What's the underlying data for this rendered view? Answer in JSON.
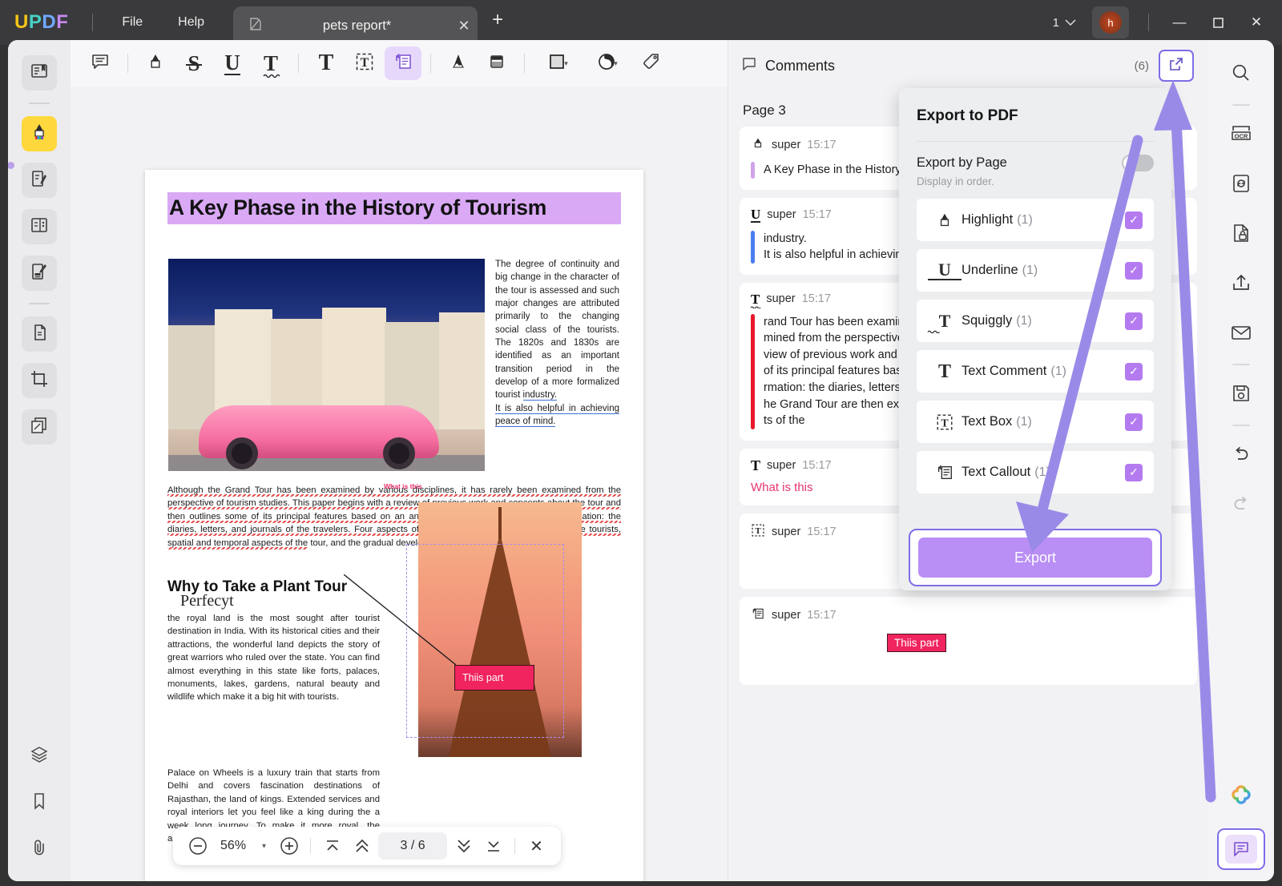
{
  "titlebar": {
    "logo": "UPDF",
    "menus": [
      "File",
      "Help"
    ],
    "tab": {
      "title": "pets report*",
      "close": "✕"
    },
    "new_tab": "+",
    "page_indicator": "1",
    "avatar_initial": "h",
    "window_controls": {
      "minimize": "—",
      "maximize": "▢",
      "close": "✕"
    }
  },
  "left_rail": [
    {
      "name": "reader-view",
      "icon": "book-icon"
    },
    {
      "name": "annotate",
      "icon": "highlighter-icon",
      "active": true
    },
    {
      "name": "edit-pdf",
      "icon": "edit-document-icon"
    },
    {
      "name": "page-organize",
      "icon": "pages-icon"
    },
    {
      "name": "form",
      "icon": "form-icon"
    },
    {
      "name": "convert",
      "icon": "convert-document-icon"
    },
    {
      "name": "crop",
      "icon": "crop-icon"
    },
    {
      "name": "batch",
      "icon": "batch-icon"
    },
    {
      "name": "layers",
      "icon": "layers-icon"
    },
    {
      "name": "bookmark",
      "icon": "bookmark-icon"
    },
    {
      "name": "attachment",
      "icon": "paperclip-icon"
    }
  ],
  "toolbar": [
    {
      "name": "note",
      "icon": "sticky-note-icon"
    },
    {
      "name": "highlight",
      "icon": "highlighter-icon"
    },
    {
      "name": "strikethrough",
      "icon": "S-strike-glyph",
      "glyph": "S"
    },
    {
      "name": "underline",
      "icon": "U-underline-glyph",
      "glyph": "U"
    },
    {
      "name": "squiggly",
      "icon": "T-squiggly-glyph",
      "glyph": "T"
    },
    {
      "name": "text-comment",
      "icon": "T-glyph",
      "glyph": "T"
    },
    {
      "name": "text-box",
      "icon": "text-box-icon",
      "glyph": "T"
    },
    {
      "name": "text-callout",
      "icon": "text-callout-icon",
      "active": true
    },
    {
      "name": "pencil",
      "icon": "pencil-icon"
    },
    {
      "name": "eraser",
      "icon": "eraser-icon"
    },
    {
      "name": "shape",
      "icon": "square-shape-icon",
      "caret": "▾"
    },
    {
      "name": "color",
      "icon": "color-wheel-icon",
      "caret": "▾"
    },
    {
      "name": "stamp",
      "icon": "tag-icon"
    }
  ],
  "document": {
    "title": "A Key Phase in the History of Tourism",
    "right_column": "The degree of continuity and big change in the character of the tour is assessed and such major changes are attributed primarily to the changing social class of the tourists. The 1820s and 1830s are identified as an important transition period in the develop of a more formalized tourist ",
    "right_column_underlined_1": "industry.",
    "right_column_underlined_2": "It is also helpful in achieving peace of mind.",
    "paragraph_squiggly": "Although the Grand Tour has been examined by various disciplines, it has rarely been examined from the perspective of tourism studies. This paper begins with a review of previous work and concepts about the tour and then outlines some of its principal features based on an analysis of the primary sources of information: the diaries, letters, and journals of the travelers. Four aspects of the Grand Tour are then examined: the tourists, spatial and temporal aspects of the",
    "paragraph_tail": " tour, and the gradual development of a tourist industry.",
    "heading2": "Why to Take a Plant Tour",
    "heading2_overlay": "Perfecyt",
    "paragraph_2": "the royal land is the most sought after tourist destination in India. With its historical cities and their attractions, the wonderful land depicts the story of great warriors who ruled over the state. You can find almost everything in this state like forts, palaces, monuments, lakes, gardens, natural beauty and wildlife which make it a big hit with tourists.",
    "paragraph_3": "Palace on Wheels is a luxury train that starts from Delhi and covers fascination destinations of Rajasthan, the land of kings. Extended services and royal interiors let you feel like a king during the a week long journey. To make it more royal, the amenities and services are provided as per the",
    "annotation_what_is_this": "What is this",
    "annotation_callout": "Thiis part"
  },
  "page_bar": {
    "zoom_out": "−",
    "zoom_level": "56%",
    "zoom_dropdown": "▾",
    "zoom_in": "+",
    "first_page": "first-page-icon",
    "prev_page": "prev-page-icon",
    "page_display": "3 / 6",
    "next_page": "next-page-icon",
    "last_page": "last-page-icon",
    "close": "✕"
  },
  "comments": {
    "title": "Comments",
    "count": "(6)",
    "page_label": "Page 3",
    "items": [
      {
        "icon": "highlighter-icon",
        "user": "super",
        "time": "15:17",
        "quote_color": "#cfa3e8",
        "text": "A Key Phase in the History",
        "style": "quote"
      },
      {
        "icon": "underline-icon",
        "user": "super",
        "time": "15:17",
        "quote_color": "#4a7df0",
        "text": "industry.\nIt is also helpful in achievin",
        "style": "quote"
      },
      {
        "icon": "squiggly-icon",
        "user": "super",
        "time": "15:17",
        "quote_color": "#e8192b",
        "text": "rand Tour has been examin\nmined from the perspective\nview of previous work and \nof its principal features bas\nrmation: the diaries, letters\nhe Grand Tour are then exa\nts of the",
        "style": "quote"
      },
      {
        "icon": "text-comment-icon",
        "user": "super",
        "time": "15:17",
        "text": "What is this",
        "style": "pink-text"
      },
      {
        "icon": "text-box-icon",
        "user": "super",
        "time": "15:17",
        "text": "Perfecyt",
        "style": "centered"
      },
      {
        "icon": "text-callout-icon",
        "user": "super",
        "time": "15:17",
        "text": "Thiis part",
        "style": "chip"
      }
    ]
  },
  "export_popover": {
    "title": "Export to PDF",
    "export_by_page_label": "Export by Page",
    "export_by_page_sub": "Display in order.",
    "export_by_page_on": false,
    "items": [
      {
        "icon": "highlighter-icon",
        "label": "Highlight",
        "count": "(1)",
        "checked": true
      },
      {
        "icon": "underline-icon",
        "label": "Underline",
        "count": "(1)",
        "checked": true
      },
      {
        "icon": "squiggly-icon",
        "label": "Squiggly",
        "count": "(1)",
        "checked": true
      },
      {
        "icon": "text-comment-icon",
        "label": "Text Comment",
        "count": "(1)",
        "checked": true
      },
      {
        "icon": "text-box-icon",
        "label": "Text Box",
        "count": "(1)",
        "checked": true
      },
      {
        "icon": "text-callout-icon",
        "label": "Text Callout",
        "count": "(1)",
        "checked": true
      }
    ],
    "export_button": "Export"
  },
  "right_rail": [
    {
      "name": "search",
      "icon": "search-icon"
    },
    {
      "name": "ocr",
      "icon": "ocr-icon"
    },
    {
      "name": "compress",
      "icon": "compress-refresh-icon"
    },
    {
      "name": "protect",
      "icon": "lock-document-icon"
    },
    {
      "name": "share",
      "icon": "share-upload-icon"
    },
    {
      "name": "email",
      "icon": "envelope-icon"
    },
    {
      "name": "save",
      "icon": "floppy-save-icon"
    },
    {
      "name": "undo",
      "icon": "undo-arrow-icon"
    },
    {
      "name": "redo",
      "icon": "redo-arrow-icon"
    },
    {
      "name": "ai-assistant",
      "icon": "ai-flower-icon"
    },
    {
      "name": "comments-toggle",
      "icon": "comment-bubble-icon"
    }
  ],
  "colors": {
    "accent_purple": "#b98ef5",
    "highlight_purple": "#d9a9f5",
    "annotation_pink": "#f0245f",
    "arrow_purple": "#9a8ae8",
    "focus_border": "#7d6ee8"
  }
}
